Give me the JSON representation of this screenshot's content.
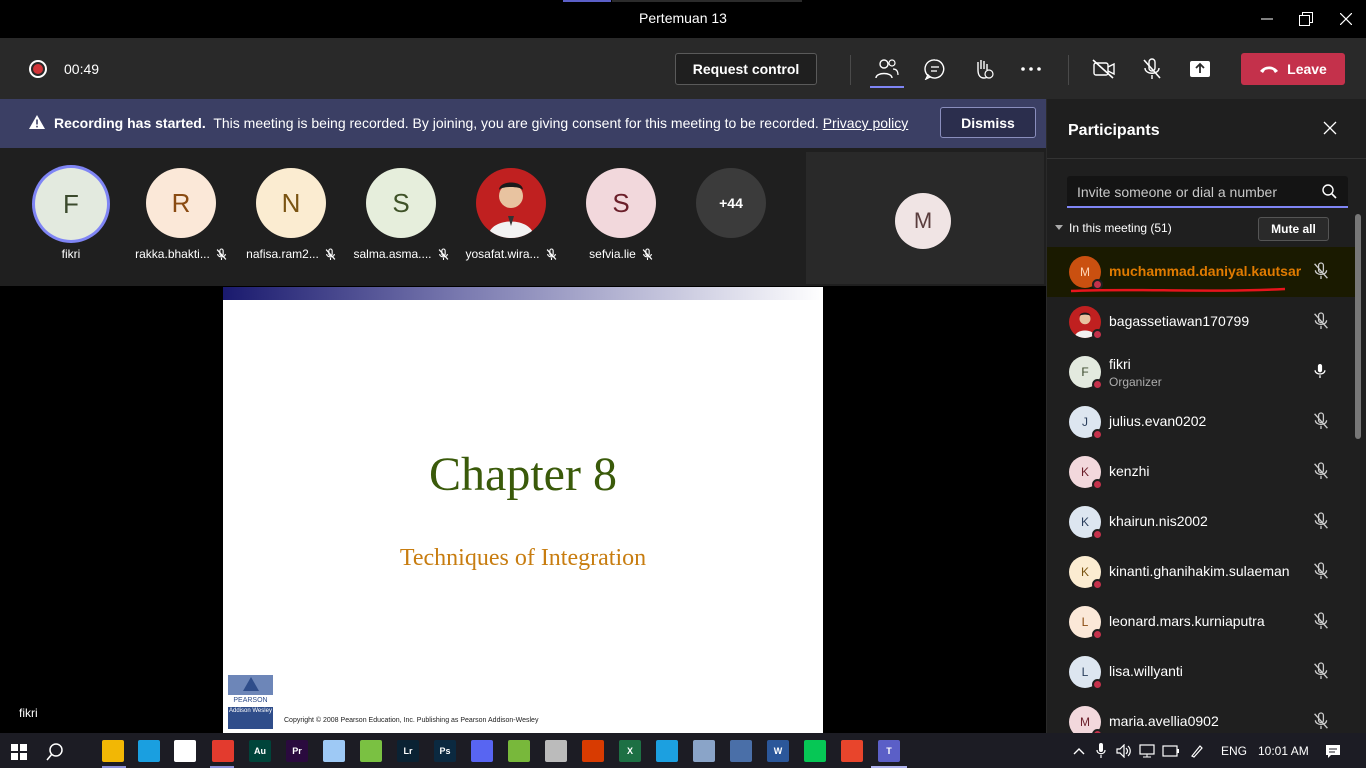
{
  "window": {
    "title": "Pertemuan 13"
  },
  "controls": {
    "timer": "00:49",
    "request_control": "Request control",
    "leave": "Leave"
  },
  "banner": {
    "bold": "Recording has started.",
    "text": "This meeting is being recorded. By joining, you are giving consent for this meeting to be recorded.",
    "link": "Privacy policy",
    "dismiss": "Dismiss"
  },
  "strip": {
    "tiles": [
      {
        "initial": "F",
        "name": "fikri",
        "bg": "#e3eadf",
        "fg": "#3b4a2d"
      },
      {
        "initial": "R",
        "name": "rakka.bhakti...",
        "bg": "#fbe8d8",
        "fg": "#8a4b12"
      },
      {
        "initial": "N",
        "name": "nafisa.ram2...",
        "bg": "#fbecd1",
        "fg": "#7a5412"
      },
      {
        "initial": "S",
        "name": "salma.asma....",
        "bg": "#e6eedc",
        "fg": "#3f5228"
      },
      {
        "initial": "",
        "name": "yosafat.wira...",
        "bg": "#c02020",
        "fg": "#ffffff"
      },
      {
        "initial": "S",
        "name": "sefvia.lie",
        "bg": "#f2d8dc",
        "fg": "#6b1f2a"
      }
    ],
    "more": "+44",
    "self_initial": "M"
  },
  "slide": {
    "title": "Chapter 8",
    "subtitle": "Techniques of Integration",
    "logo_brand": "PEARSON",
    "logo_sub": "Addison Wesley",
    "copyright": "Copyright © 2008 Pearson Education, Inc.  Publishing as Pearson Addison-Wesley"
  },
  "presenter_name": "fikri",
  "panel": {
    "title": "Participants",
    "search_placeholder": "Invite someone or dial a number",
    "section": "In this meeting (51)",
    "mute_all": "Mute all",
    "people": [
      {
        "initial": "M",
        "name": "muchammad.daniyal.kautsar",
        "role": "",
        "bg": "#ca5010",
        "fg": "#ffd7b8",
        "mic": "muted",
        "highlight": true
      },
      {
        "initial": "",
        "name": "bagassetiawan170799",
        "role": "",
        "bg": "#c02020",
        "fg": "#ffffff",
        "mic": "muted",
        "highlight": false
      },
      {
        "initial": "F",
        "name": "fikri",
        "role": "Organizer",
        "bg": "#e3eadf",
        "fg": "#3b4a2d",
        "mic": "on",
        "highlight": false
      },
      {
        "initial": "J",
        "name": "julius.evan0202",
        "role": "",
        "bg": "#dde6f0",
        "fg": "#2b3f5c",
        "mic": "muted",
        "highlight": false
      },
      {
        "initial": "K",
        "name": "kenzhi",
        "role": "",
        "bg": "#f2d8dc",
        "fg": "#6b1f2a",
        "mic": "muted",
        "highlight": false
      },
      {
        "initial": "K",
        "name": "khairun.nis2002",
        "role": "",
        "bg": "#dde6f0",
        "fg": "#2b3f5c",
        "mic": "muted",
        "highlight": false
      },
      {
        "initial": "K",
        "name": "kinanti.ghanihakim.sulaeman",
        "role": "",
        "bg": "#fbecd1",
        "fg": "#7a5412",
        "mic": "muted",
        "highlight": false
      },
      {
        "initial": "L",
        "name": "leonard.mars.kurniaputra",
        "role": "",
        "bg": "#fbe8d8",
        "fg": "#8a4b12",
        "mic": "muted",
        "highlight": false
      },
      {
        "initial": "L",
        "name": "lisa.willyanti",
        "role": "",
        "bg": "#dde6f0",
        "fg": "#2b3f5c",
        "mic": "muted",
        "highlight": false
      },
      {
        "initial": "M",
        "name": "maria.avellia0902",
        "role": "",
        "bg": "#f2d8dc",
        "fg": "#6b1f2a",
        "mic": "muted",
        "highlight": false
      }
    ]
  },
  "taskbar": {
    "lang": "ENG",
    "time": "10:01 AM",
    "apps": [
      {
        "icon": "file-explorer-icon",
        "label": "",
        "color": "#f2b705"
      },
      {
        "icon": "edge-icon",
        "label": "",
        "color": "#1a9fe0"
      },
      {
        "icon": "store-icon",
        "label": "",
        "color": "#ffffff"
      },
      {
        "icon": "chrome-icon",
        "label": "",
        "color": "#e33b2e"
      },
      {
        "icon": "audition-icon",
        "label": "Au",
        "color": "#00443a"
      },
      {
        "icon": "premiere-icon",
        "label": "Pr",
        "color": "#2a0a3e"
      },
      {
        "icon": "notepad-icon",
        "label": "",
        "color": "#9ec9f5"
      },
      {
        "icon": "play-icon",
        "label": "",
        "color": "#7ac142"
      },
      {
        "icon": "lightroom-icon",
        "label": "Lr",
        "color": "#0a2233"
      },
      {
        "icon": "photoshop-icon",
        "label": "Ps",
        "color": "#0b2940"
      },
      {
        "icon": "discord-icon",
        "label": "",
        "color": "#5865f2"
      },
      {
        "icon": "utorrent-icon",
        "label": "",
        "color": "#78b83b"
      },
      {
        "icon": "app-icon",
        "label": "",
        "color": "#bbbbbb"
      },
      {
        "icon": "app-icon",
        "label": "",
        "color": "#d83b01"
      },
      {
        "icon": "excel-icon",
        "label": "X",
        "color": "#1d7044"
      },
      {
        "icon": "ie-icon",
        "label": "",
        "color": "#1ca0e0"
      },
      {
        "icon": "app-icon",
        "label": "",
        "color": "#8aa4c8"
      },
      {
        "icon": "app-icon",
        "label": "",
        "color": "#4a6fa8"
      },
      {
        "icon": "word-icon",
        "label": "W",
        "color": "#2b579a"
      },
      {
        "icon": "line-icon",
        "label": "",
        "color": "#06c755"
      },
      {
        "icon": "app-icon",
        "label": "",
        "color": "#e8452c"
      },
      {
        "icon": "teams-icon",
        "label": "T",
        "color": "#5b5fc7"
      }
    ]
  }
}
